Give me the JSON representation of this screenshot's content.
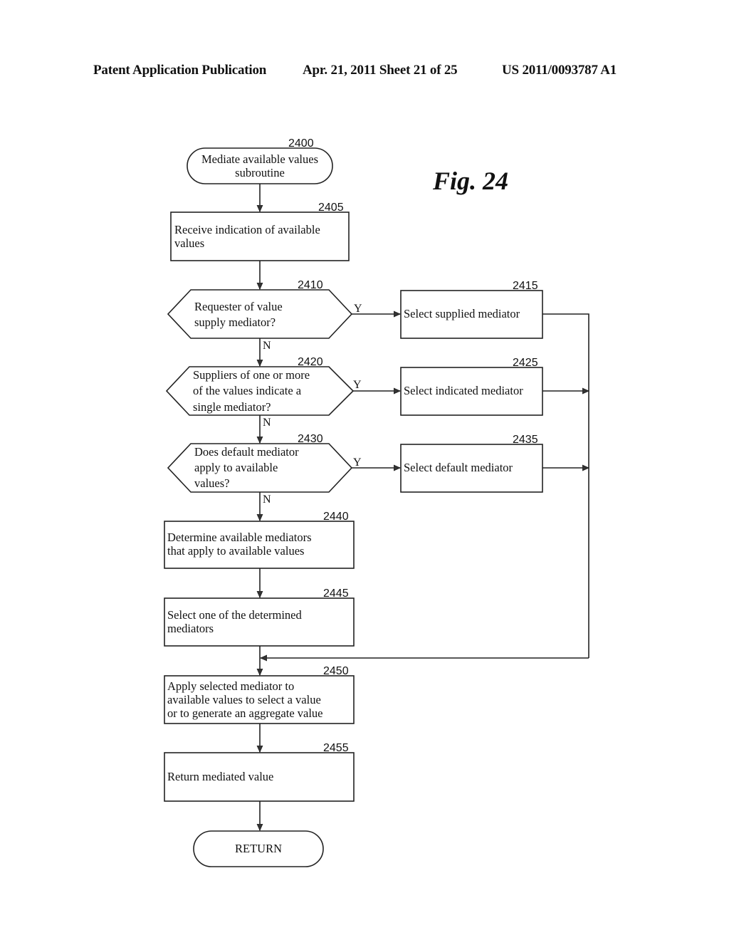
{
  "header": {
    "left": "Patent Application Publication",
    "date_sheet": "Apr. 21, 2011  Sheet 21 of 25",
    "pub_number": "US 2011/0093787 A1"
  },
  "figure_label": "Fig. 24",
  "nodes": {
    "n2400": {
      "ref": "2400",
      "type": "terminal",
      "lines": [
        "Mediate available values",
        "subroutine"
      ]
    },
    "n2405": {
      "ref": "2405",
      "type": "process",
      "lines": [
        "Receive indication of available",
        "values"
      ]
    },
    "n2410": {
      "ref": "2410",
      "type": "decision",
      "lines": [
        "Requester of value",
        "supply mediator?"
      ]
    },
    "n2415": {
      "ref": "2415",
      "type": "process",
      "lines": [
        "Select supplied mediator"
      ]
    },
    "n2420": {
      "ref": "2420",
      "type": "decision",
      "lines": [
        "Suppliers of one or more",
        "of the values indicate a",
        "single mediator?"
      ]
    },
    "n2425": {
      "ref": "2425",
      "type": "process",
      "lines": [
        "Select indicated mediator"
      ]
    },
    "n2430": {
      "ref": "2430",
      "type": "decision",
      "lines": [
        "Does default mediator",
        "apply to available",
        "values?"
      ]
    },
    "n2435": {
      "ref": "2435",
      "type": "process",
      "lines": [
        "Select default mediator"
      ]
    },
    "n2440": {
      "ref": "2440",
      "type": "process",
      "lines": [
        "Determine available mediators",
        "that apply to available values"
      ]
    },
    "n2445": {
      "ref": "2445",
      "type": "process",
      "lines": [
        "Select one of the determined",
        "mediators"
      ]
    },
    "n2450": {
      "ref": "2450",
      "type": "process",
      "lines": [
        "Apply selected mediator to",
        "available values to select a value",
        "or to generate an aggregate value"
      ]
    },
    "n2455": {
      "ref": "2455",
      "type": "process",
      "lines": [
        "Return mediated value"
      ]
    },
    "return": {
      "ref": "",
      "type": "terminal",
      "lines": [
        "RETURN"
      ]
    }
  },
  "edges": [
    {
      "from": "2400",
      "to": "2405",
      "label": ""
    },
    {
      "from": "2405",
      "to": "2410",
      "label": ""
    },
    {
      "from": "2410",
      "to": "2415",
      "label": "Y"
    },
    {
      "from": "2410",
      "to": "2420",
      "label": "N"
    },
    {
      "from": "2420",
      "to": "2425",
      "label": "Y"
    },
    {
      "from": "2420",
      "to": "2430",
      "label": "N"
    },
    {
      "from": "2430",
      "to": "2435",
      "label": "Y"
    },
    {
      "from": "2430",
      "to": "2440",
      "label": "N"
    },
    {
      "from": "2440",
      "to": "2445",
      "label": ""
    },
    {
      "from": "2415",
      "to": "2450",
      "label": ""
    },
    {
      "from": "2425",
      "to": "2450",
      "label": ""
    },
    {
      "from": "2435",
      "to": "2450",
      "label": ""
    },
    {
      "from": "2445",
      "to": "2450",
      "label": ""
    },
    {
      "from": "2450",
      "to": "2455",
      "label": ""
    },
    {
      "from": "2455",
      "to": "RETURN",
      "label": ""
    }
  ],
  "branch_labels": {
    "yes": "Y",
    "no": "N"
  }
}
